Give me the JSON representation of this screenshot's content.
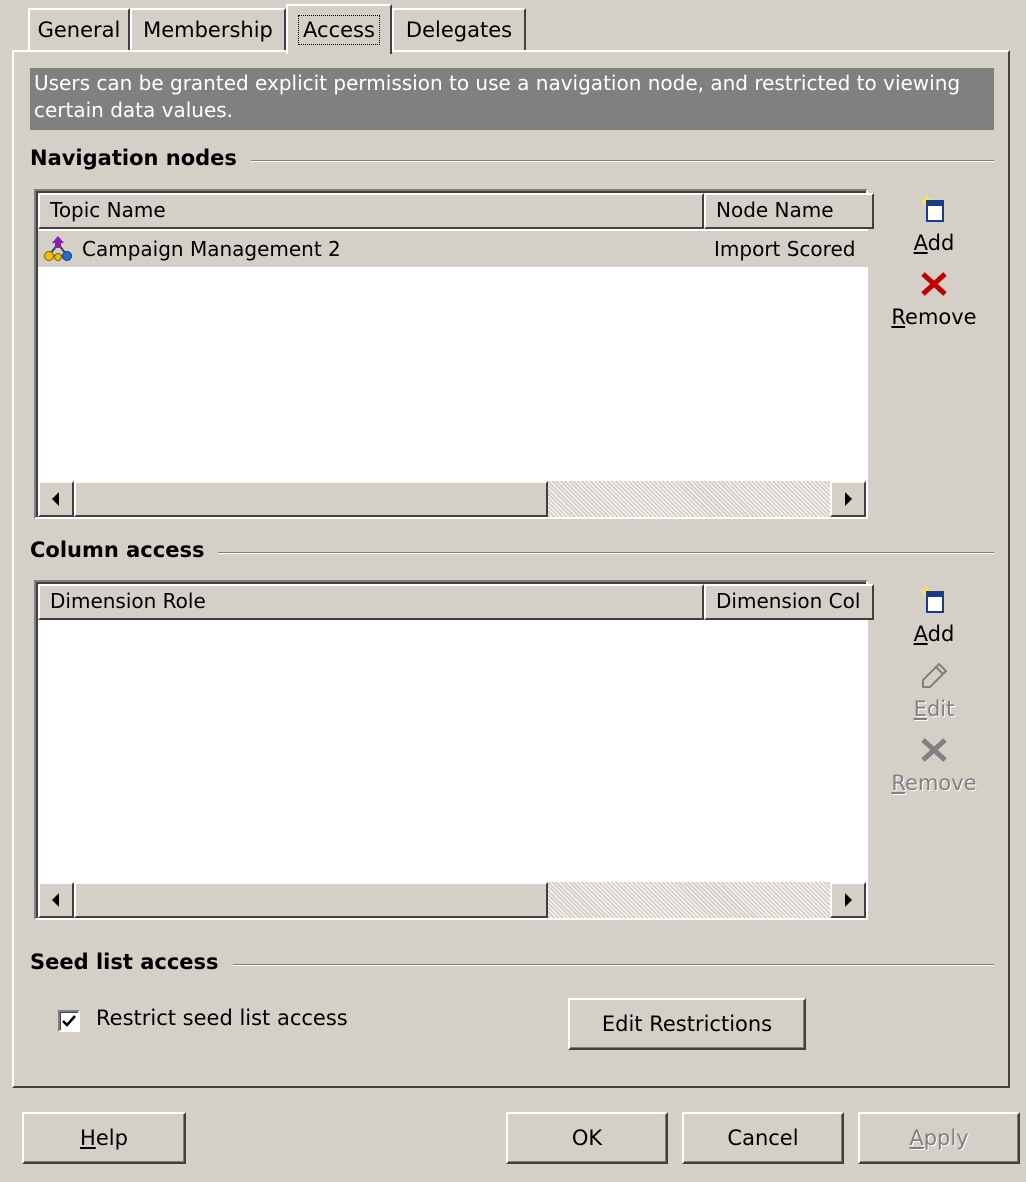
{
  "tabs": [
    {
      "label": "General",
      "active": false
    },
    {
      "label": "Membership",
      "active": false
    },
    {
      "label": "Access",
      "active": true
    },
    {
      "label": "Delegates",
      "active": false
    }
  ],
  "info_text": "Users can be granted explicit permission to use a navigation node, and restricted to viewing certain data values.",
  "navigation": {
    "title": "Navigation nodes",
    "columns": [
      "Topic Name",
      "Node Name"
    ],
    "rows": [
      {
        "topic": "Campaign Management 2",
        "node": "Import Scored",
        "icon": "hierarchy-node-icon"
      }
    ],
    "actions": {
      "add": {
        "label": "Add",
        "accesskey": "A",
        "enabled": true,
        "icon": "add-item-icon"
      },
      "remove": {
        "label": "Remove",
        "accesskey": "R",
        "enabled": true,
        "icon": "remove-x-icon",
        "color": "#c00000"
      }
    }
  },
  "column_access": {
    "title": "Column access",
    "columns": [
      "Dimension Role",
      "Dimension Col"
    ],
    "rows": [],
    "actions": {
      "add": {
        "label": "Add",
        "accesskey": "A",
        "enabled": true,
        "icon": "add-item-icon"
      },
      "edit": {
        "label": "Edit",
        "accesskey": "E",
        "enabled": false,
        "icon": "pencil-icon"
      },
      "remove": {
        "label": "Remove",
        "accesskey": "R",
        "enabled": false,
        "icon": "remove-x-icon",
        "color": "#808080"
      }
    }
  },
  "seed_list": {
    "title": "Seed list access",
    "checkbox_label": "Restrict seed list access",
    "checked": true,
    "edit_button": "Edit Restrictions"
  },
  "footer": {
    "help": {
      "label": "Help",
      "accesskey": "H",
      "enabled": true
    },
    "ok": {
      "label": "OK",
      "enabled": true
    },
    "cancel": {
      "label": "Cancel",
      "enabled": true
    },
    "apply": {
      "label": "Apply",
      "accesskey": "A",
      "enabled": false
    }
  }
}
